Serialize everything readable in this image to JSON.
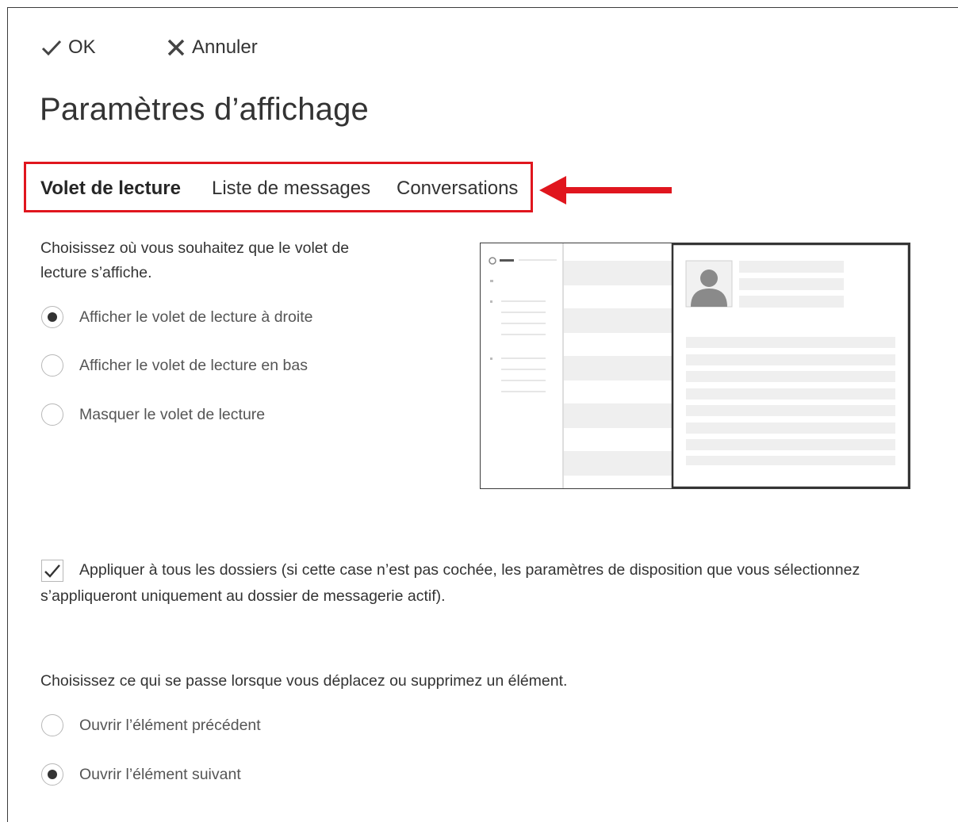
{
  "toolbar": {
    "ok_label": "OK",
    "cancel_label": "Annuler"
  },
  "page": {
    "title": "Paramètres d’affichage"
  },
  "tabs": [
    {
      "label": "Volet de lecture",
      "active": true
    },
    {
      "label": "Liste de messages",
      "active": false
    },
    {
      "label": "Conversations",
      "active": false
    }
  ],
  "annotation": {
    "highlight_color": "#e0161e",
    "arrow_icon": "left-arrow-icon"
  },
  "reading_pane": {
    "prompt_line1": "Choisissez où vous souhaitez que le volet de",
    "prompt_line2": "lecture s’affiche.",
    "options": [
      {
        "label": "Afficher le volet de lecture à droite",
        "selected": true
      },
      {
        "label": "Afficher le volet de lecture en bas",
        "selected": false
      },
      {
        "label": "Masquer le volet de lecture",
        "selected": false
      }
    ],
    "preview_icon": "person-avatar-icon"
  },
  "apply_all": {
    "checked": true,
    "line1": "Appliquer à tous les dossiers (si cette case n’est pas cochée, les paramètres de disposition que vous sélectionnez",
    "line2": "s’appliqueront uniquement au dossier de messagerie actif)."
  },
  "move_delete": {
    "prompt": "Choisissez ce qui se passe lorsque vous déplacez ou supprimez un élément.",
    "options": [
      {
        "label": "Ouvrir l’élément précédent",
        "selected": false
      },
      {
        "label": "Ouvrir l’élément suivant",
        "selected": true
      }
    ]
  }
}
